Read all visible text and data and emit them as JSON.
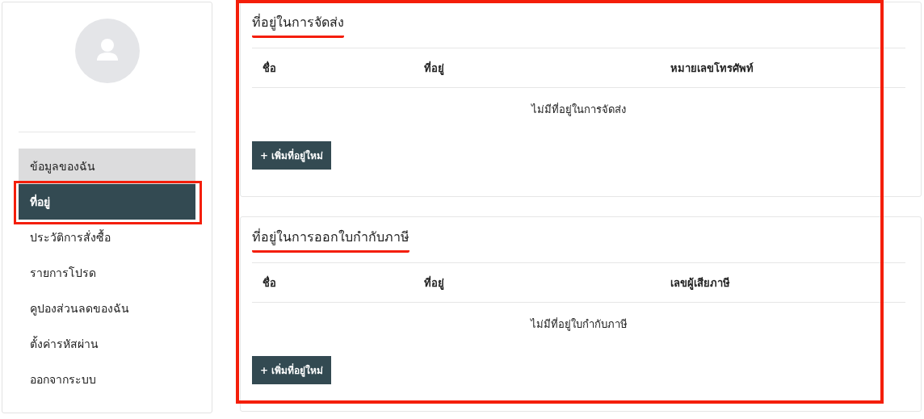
{
  "sidebar": {
    "items": [
      {
        "label": "ข้อมูลของฉัน",
        "selected": false,
        "hovered": true,
        "annotated": false
      },
      {
        "label": "ที่อยู่",
        "selected": true,
        "hovered": false,
        "annotated": true
      },
      {
        "label": "ประวัติการสั่งซื้อ",
        "selected": false,
        "hovered": false,
        "annotated": false
      },
      {
        "label": "รายการโปรด",
        "selected": false,
        "hovered": false,
        "annotated": false
      },
      {
        "label": "คูปองส่วนลดของฉัน",
        "selected": false,
        "hovered": false,
        "annotated": false
      },
      {
        "label": "ตั้งค่ารหัสผ่าน",
        "selected": false,
        "hovered": false,
        "annotated": false
      },
      {
        "label": "ออกจากระบบ",
        "selected": false,
        "hovered": false,
        "annotated": false
      }
    ]
  },
  "sections": [
    {
      "title": "ที่อยู่ในการจัดส่ง",
      "columns": [
        "ชื่อ",
        "ที่อยู่",
        "หมายเลขโทรศัพท์"
      ],
      "empty_message": "ไม่มีที่อยู่ในการจัดส่ง",
      "button": "+ เพิ่มที่อยู่ใหม่"
    },
    {
      "title": "ที่อยู่ในการออกใบกำกับภาษี",
      "columns": [
        "ชื่อ",
        "ที่อยู่",
        "เลขผู้เสียภาษี"
      ],
      "empty_message": "ไม่มีที่อยู่ใบกำกับภาษี",
      "button": "+ เพิ่มที่อยู่ใหม่"
    }
  ]
}
